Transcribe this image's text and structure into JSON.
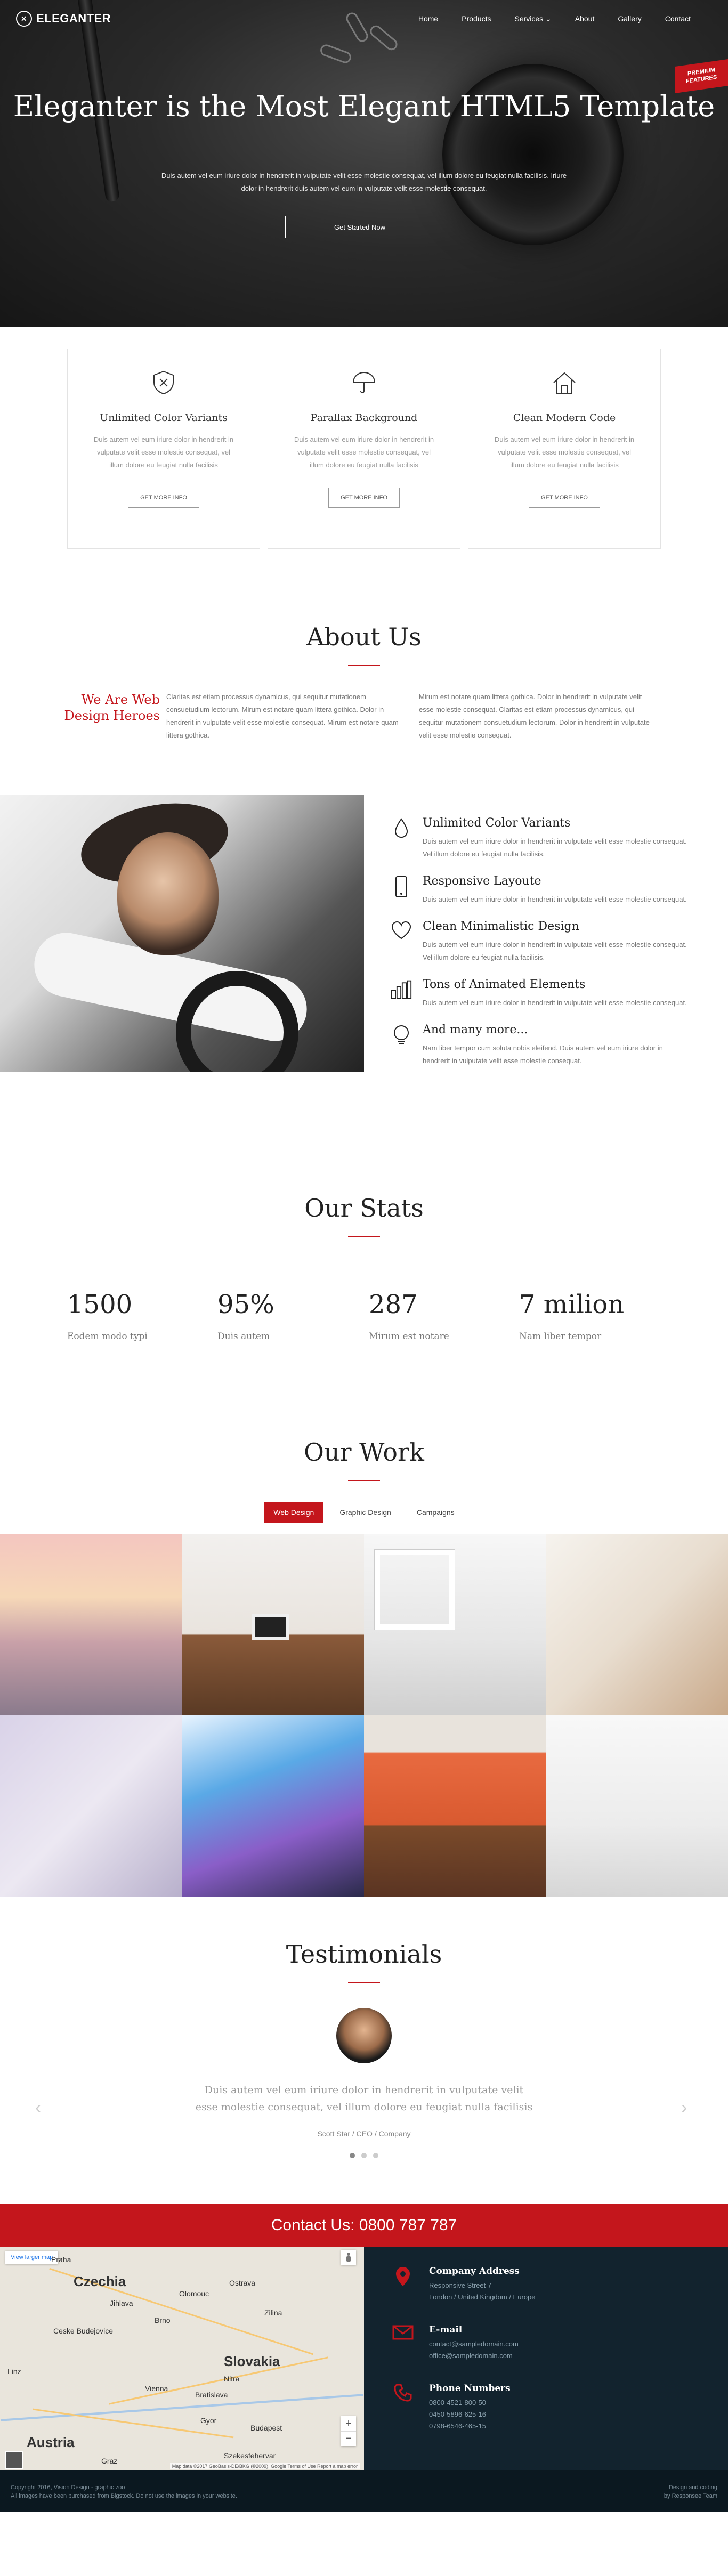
{
  "colors": {
    "accent": "#c4161c",
    "dark": "#12232e"
  },
  "brand": {
    "name": "ELEGANTER"
  },
  "nav": {
    "items": [
      "Home",
      "Products",
      "Services",
      "About",
      "Gallery",
      "Contact"
    ]
  },
  "hero": {
    "badge": "PREMIUM FEATURES",
    "title": "Eleganter is the Most Elegant HTML5 Template",
    "text": "Duis autem vel eum iriure dolor in hendrerit in vulputate velit esse molestie consequat, vel illum dolore eu feugiat nulla facilisis. Iriure dolor in hendrerit duis autem vel eum in vulputate velit esse molestie consequat.",
    "cta": "Get Started Now"
  },
  "features": [
    {
      "icon": "shield-icon",
      "title": "Unlimited Color Variants",
      "text": "Duis autem vel eum iriure dolor in hendrerit in vulputate velit esse molestie consequat, vel illum dolore eu feugiat nulla facilisis",
      "button": "GET MORE INFO"
    },
    {
      "icon": "umbrella-icon",
      "title": "Parallax Background",
      "text": "Duis autem vel eum iriure dolor in hendrerit in vulputate velit esse molestie consequat, vel illum dolore eu feugiat nulla facilisis",
      "button": "GET MORE INFO"
    },
    {
      "icon": "home-icon",
      "title": "Clean Modern Code",
      "text": "Duis autem vel eum iriure dolor in hendrerit in vulputate velit esse molestie consequat, vel illum dolore eu feugiat nulla facilisis",
      "button": "GET MORE INFO"
    }
  ],
  "about": {
    "title": "About Us",
    "tagline": "We Are Web Design Heroes",
    "col1": "Claritas est etiam processus dynamicus, qui sequitur mutationem consuetudium lectorum. Mirum est notare quam littera gothica. Dolor in hendrerit in vulputate velit esse molestie consequat. Mirum est notare quam littera gothica.",
    "col2": "Mirum est notare quam littera gothica. Dolor in hendrerit in vulputate velit esse molestie consequat. Claritas est etiam processus dynamicus, qui sequitur mutationem consuetudium lectorum. Dolor in hendrerit in vulputate velit esse molestie consequat."
  },
  "highlights": [
    {
      "icon": "drop-icon",
      "title": "Unlimited Color Variants",
      "text": "Duis autem vel eum iriure dolor in hendrerit in vulputate velit esse molestie consequat. Vel illum dolore eu feugiat nulla facilisis."
    },
    {
      "icon": "phone-icon",
      "title": "Responsive Layoute",
      "text": "Duis autem vel eum iriure dolor in hendrerit in vulputate velit esse molestie consequat."
    },
    {
      "icon": "heart-icon",
      "title": "Clean Minimalistic Design",
      "text": "Duis autem vel eum iriure dolor in hendrerit in vulputate velit esse molestie consequat. Vel illum dolore eu feugiat nulla facilisis."
    },
    {
      "icon": "bar-chart-icon",
      "title": "Tons of Animated Elements",
      "text": "Duis autem vel eum iriure dolor in hendrerit in vulputate velit esse molestie consequat."
    },
    {
      "icon": "bulb-icon",
      "title": "And many more...",
      "text": "Nam liber tempor cum soluta nobis eleifend. Duis autem vel eum iriure dolor in hendrerit in vulputate velit esse molestie consequat."
    }
  ],
  "stats": {
    "title": "Our Stats",
    "items": [
      {
        "value": "1500",
        "label": "Eodem modo typi"
      },
      {
        "value": "95%",
        "label": "Duis autem"
      },
      {
        "value": "287",
        "label": "Mirum est notare"
      },
      {
        "value": "7 milion",
        "label": "Nam liber tempor"
      }
    ]
  },
  "work": {
    "title": "Our Work",
    "tabs": [
      "Web Design",
      "Graphic Design",
      "Campaigns"
    ],
    "active_tab": 0
  },
  "testimonials": {
    "title": "Testimonials",
    "quote": "Duis autem vel eum iriure dolor in hendrerit in vulputate velit esse molestie consequat, vel illum dolore eu feugiat nulla facilisis",
    "author": "Scott Star / CEO / Company"
  },
  "contact": {
    "bar": "Contact Us: 0800 787 787",
    "map": {
      "view_label": "View larger map",
      "cities": [
        "Czechia",
        "Slovakia",
        "Austria",
        "Praha",
        "Brno",
        "Vienna",
        "Bratislava",
        "Budapest",
        "Graz",
        "Linz",
        "Olomouc",
        "Ostrava",
        "Zilina",
        "Nitra",
        "Gyor",
        "Szekesfehervar",
        "Ceske Budejovice",
        "Jihlava"
      ],
      "attribution": "Map data ©2017 GeoBasis-DE/BKG (©2009), Google   Terms of Use   Report a map error"
    },
    "items": [
      {
        "icon": "map-pin-icon",
        "title": "Company Address",
        "lines": [
          "Responsive Street 7",
          "London / United Kingdom / Europe"
        ]
      },
      {
        "icon": "mail-icon",
        "title": "E-mail",
        "lines": [
          "contact@sampledomain.com",
          "office@sampledomain.com"
        ]
      },
      {
        "icon": "phone-icon",
        "title": "Phone Numbers",
        "lines": [
          "0800-4521-800-50",
          "0450-5896-625-16",
          "0798-6546-465-15"
        ]
      }
    ]
  },
  "footer": {
    "left1": "Copyright 2016, Vision Design - graphic zoo",
    "left2": "All images have been purchased from Bigstock. Do not use the images in your website.",
    "right1": "Design and coding",
    "right2": "by Responsee Team"
  }
}
